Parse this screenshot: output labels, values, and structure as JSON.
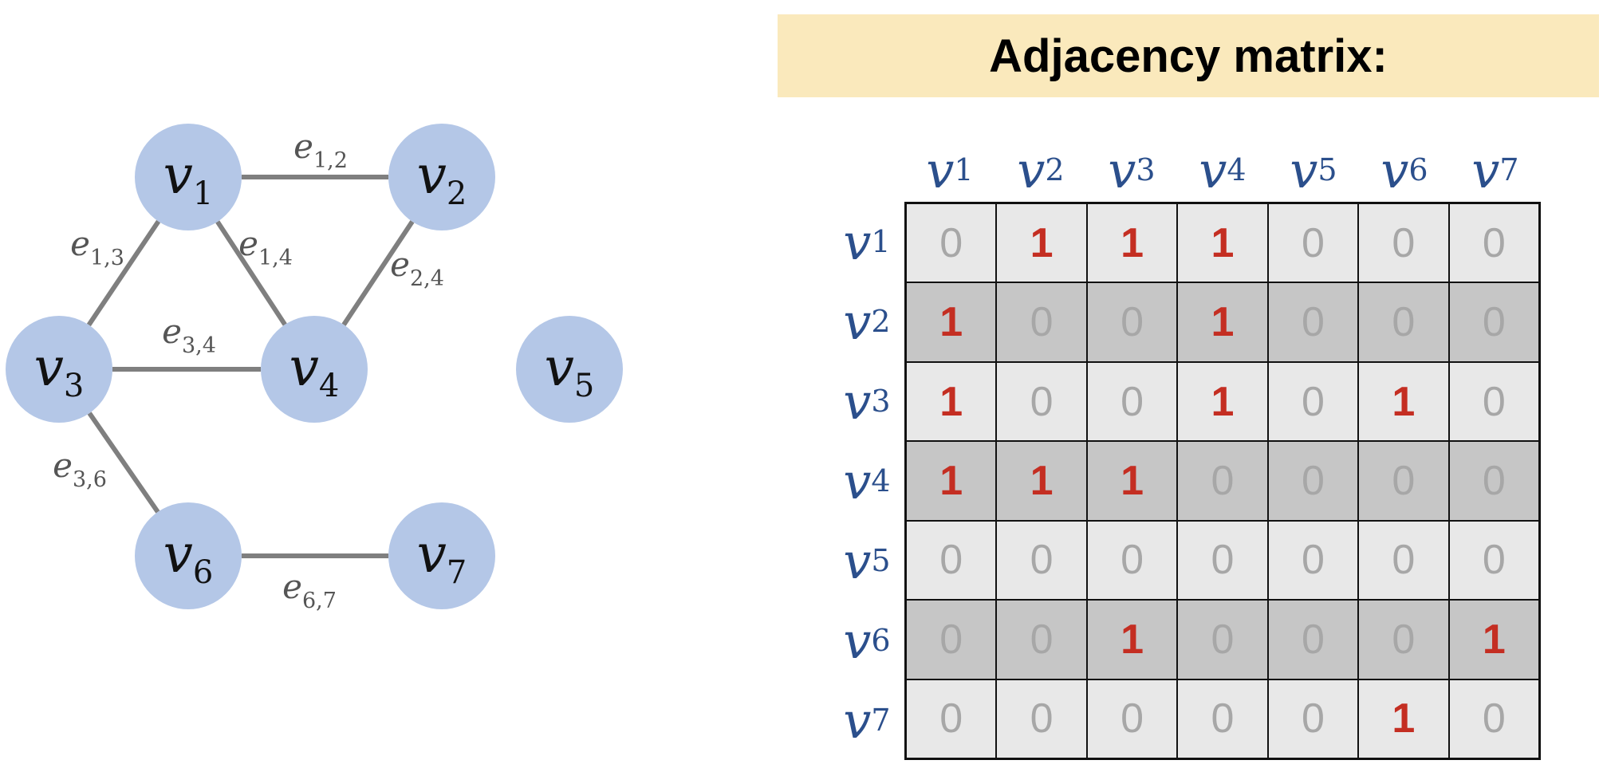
{
  "colors": {
    "node_fill": "#b4c7e7",
    "edge_stroke": "#7f7f7f",
    "title_bg": "#fae9bc",
    "header_text": "#2b4f8c",
    "one_text": "#c42e22",
    "zero_text": "#a7a7a7",
    "row_odd_bg": "#e8e8e8",
    "row_even_bg": "#c6c6c6"
  },
  "graph": {
    "nodes": [
      {
        "id": "v1",
        "var": "v",
        "sub": "1"
      },
      {
        "id": "v2",
        "var": "v",
        "sub": "2"
      },
      {
        "id": "v3",
        "var": "v",
        "sub": "3"
      },
      {
        "id": "v4",
        "var": "v",
        "sub": "4"
      },
      {
        "id": "v5",
        "var": "v",
        "sub": "5"
      },
      {
        "id": "v6",
        "var": "v",
        "sub": "6"
      },
      {
        "id": "v7",
        "var": "v",
        "sub": "7"
      }
    ],
    "edges": [
      {
        "from": "v1",
        "to": "v2",
        "var": "e",
        "sub": "1,2"
      },
      {
        "from": "v1",
        "to": "v3",
        "var": "e",
        "sub": "1,3"
      },
      {
        "from": "v1",
        "to": "v4",
        "var": "e",
        "sub": "1,4"
      },
      {
        "from": "v2",
        "to": "v4",
        "var": "e",
        "sub": "2,4"
      },
      {
        "from": "v3",
        "to": "v4",
        "var": "e",
        "sub": "3,4"
      },
      {
        "from": "v3",
        "to": "v6",
        "var": "e",
        "sub": "3,6"
      },
      {
        "from": "v6",
        "to": "v7",
        "var": "e",
        "sub": "6,7"
      }
    ]
  },
  "matrix": {
    "title": "Adjacency matrix:",
    "headers": [
      {
        "var": "v",
        "sub": "1"
      },
      {
        "var": "v",
        "sub": "2"
      },
      {
        "var": "v",
        "sub": "3"
      },
      {
        "var": "v",
        "sub": "4"
      },
      {
        "var": "v",
        "sub": "5"
      },
      {
        "var": "v",
        "sub": "6"
      },
      {
        "var": "v",
        "sub": "7"
      }
    ],
    "values": [
      [
        0,
        1,
        1,
        1,
        0,
        0,
        0
      ],
      [
        1,
        0,
        0,
        1,
        0,
        0,
        0
      ],
      [
        1,
        0,
        0,
        1,
        0,
        1,
        0
      ],
      [
        1,
        1,
        1,
        0,
        0,
        0,
        0
      ],
      [
        0,
        0,
        0,
        0,
        0,
        0,
        0
      ],
      [
        0,
        0,
        1,
        0,
        0,
        0,
        1
      ],
      [
        0,
        0,
        0,
        0,
        0,
        1,
        0
      ]
    ]
  }
}
